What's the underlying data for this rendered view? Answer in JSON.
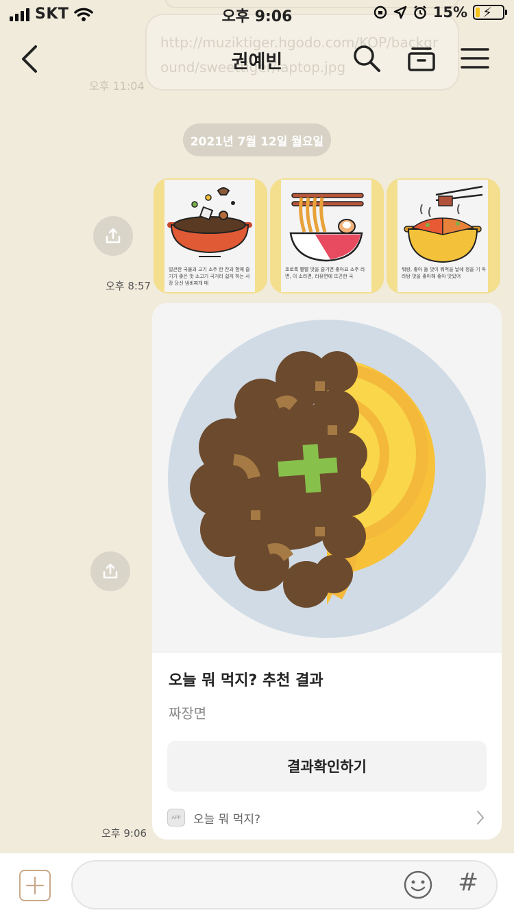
{
  "status": {
    "carrier": "SKT",
    "time": "오후 9:06",
    "battery": "15%"
  },
  "header": {
    "title": "권예빈",
    "back_icon": "chevron-left-icon",
    "search_icon": "search-icon",
    "drawer_icon": "drawer-icon",
    "menu_icon": "hamburger-menu-icon"
  },
  "background": {
    "ghost_link": "http://muziktiger.hgodo.com/KOP/background/sweettiger/laptop.jpg",
    "ghost_time": "오후 11:04"
  },
  "chat": {
    "date_divider": "2021년 7월 12일 월요일",
    "image_message": {
      "time": "오후 8:57",
      "tiles": [
        {
          "caption": "얼큰한 국물과 고기 소주 한 잔과 함께 즐기기 좋은 맛 소고기 국거리 쉽게 하는 사장 당신 냄비찌개 매"
        },
        {
          "caption": "호로록 빨빨 맛을 즐기면 좋아요 소주 라면, 이 소라면, 라유면에 뜨끈한 국"
        },
        {
          "caption": "뭐랑, 좋아 둘 맛이 뭐먹을 날에 정을 기 마라탕 맛을 좋아해 좋아 맛있어"
        }
      ]
    },
    "card_message": {
      "time": "오후 9:06",
      "title": "오늘 뭐 먹지? 추천 결과",
      "result": "짜장면",
      "button_label": "결과확인하기",
      "footer_badge": "APP",
      "footer_label": "오늘 뭐 먹지?"
    }
  },
  "input": {
    "value": "",
    "plus_icon": "plus-icon",
    "emoji_icon": "emoji-icon",
    "hash_label": "#"
  },
  "colors": {
    "chat_bg": "#f1ebdc",
    "tile_bg": "#f3df8e",
    "date_pill": "#d7d2c5",
    "noodle": "#f9d64a",
    "sauce": "#6b4a2e",
    "plate": "#d0dbe5",
    "scallion": "#88c04c"
  }
}
